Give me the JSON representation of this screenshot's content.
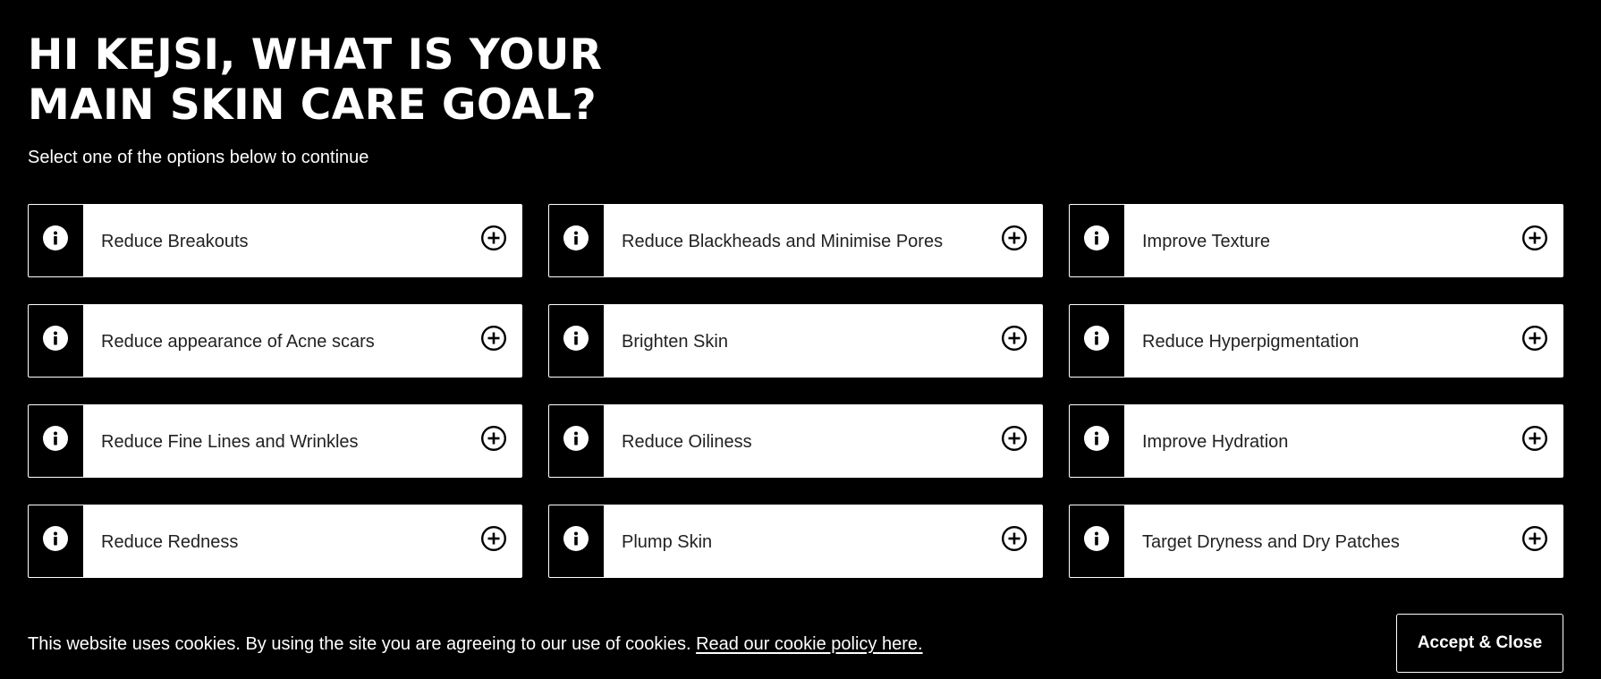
{
  "page": {
    "title": "HI KEJSI, WHAT IS YOUR MAIN SKIN CARE GOAL?",
    "subtitle": "Select one of the options below to continue"
  },
  "goals": [
    {
      "label": "Reduce Breakouts",
      "info_icon": "info-icon",
      "add_icon": "plus-circle-icon"
    },
    {
      "label": "Reduce Blackheads and Minimise Pores",
      "info_icon": "info-icon",
      "add_icon": "plus-circle-icon"
    },
    {
      "label": "Improve Texture",
      "info_icon": "info-icon",
      "add_icon": "plus-circle-icon"
    },
    {
      "label": "Reduce appearance of Acne scars",
      "info_icon": "info-icon",
      "add_icon": "plus-circle-icon"
    },
    {
      "label": "Brighten Skin",
      "info_icon": "info-icon",
      "add_icon": "plus-circle-icon"
    },
    {
      "label": "Reduce Hyperpigmentation",
      "info_icon": "info-icon",
      "add_icon": "plus-circle-icon"
    },
    {
      "label": "Reduce Fine Lines and Wrinkles",
      "info_icon": "info-icon",
      "add_icon": "plus-circle-icon"
    },
    {
      "label": "Reduce Oiliness",
      "info_icon": "info-icon",
      "add_icon": "plus-circle-icon"
    },
    {
      "label": "Improve Hydration",
      "info_icon": "info-icon",
      "add_icon": "plus-circle-icon"
    },
    {
      "label": "Reduce Redness",
      "info_icon": "info-icon",
      "add_icon": "plus-circle-icon"
    },
    {
      "label": "Plump Skin",
      "info_icon": "info-icon",
      "add_icon": "plus-circle-icon"
    },
    {
      "label": "Target Dryness and Dry Patches",
      "info_icon": "info-icon",
      "add_icon": "plus-circle-icon"
    }
  ],
  "cookie_banner": {
    "text": "This website uses cookies. By using the site you are agreeing to our use of cookies.",
    "link_text": "Read our cookie policy here.",
    "button_label": "Accept & Close"
  },
  "colors": {
    "background": "#000000",
    "card_background": "#ffffff",
    "card_text": "#222222",
    "info_panel": "#000000",
    "text_light": "#ffffff"
  }
}
